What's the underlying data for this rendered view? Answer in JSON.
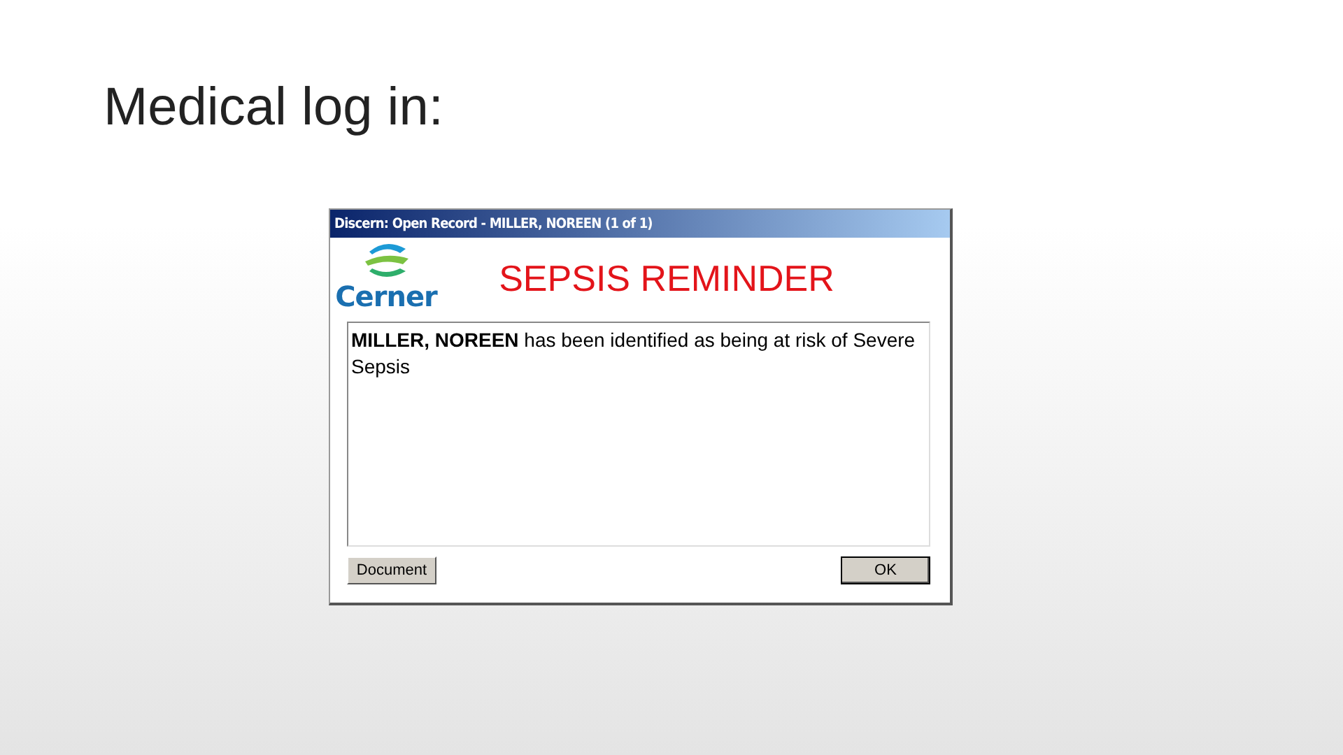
{
  "slide": {
    "title": "Medical log in:"
  },
  "dialog": {
    "title": "Discern: Open Record - MILLER, NOREEN (1 of 1)",
    "logo_text": "Cerner",
    "heading": "SEPSIS REMINDER",
    "message": "**MILLER, NOREEN** has been identified as being at risk of Severe Sepsis",
    "buttons": [
      {
        "label": "Document",
        "default": false
      },
      {
        "label": "OK",
        "default": true
      }
    ]
  }
}
